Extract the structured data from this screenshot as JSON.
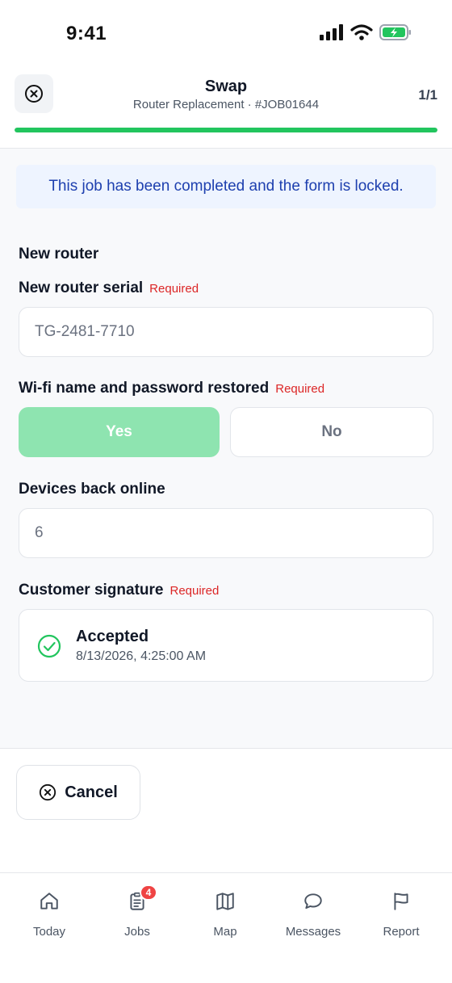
{
  "status_bar": {
    "time": "9:41"
  },
  "header": {
    "title": "Swap",
    "subtitle": "Router Replacement · #JOB01644",
    "step_count": "1/1",
    "progress": 1.0
  },
  "form": {
    "locked_message": "This job has been completed and the form is locked.",
    "section_title": "New router",
    "required_label": "Required",
    "router_serial": {
      "label": "New router serial",
      "value": "TG-2481-7710"
    },
    "wifi_restored": {
      "label": "Wi-fi name and password restored",
      "yes_label": "Yes",
      "no_label": "No",
      "selected": "Yes"
    },
    "devices_online": {
      "label": "Devices back online",
      "value": "6"
    },
    "signature": {
      "label": "Customer signature",
      "status": "Accepted",
      "timestamp": "8/13/2026, 4:25:00 AM"
    }
  },
  "footer": {
    "cancel_label": "Cancel"
  },
  "nav": {
    "items": [
      {
        "label": "Today",
        "icon": "home-icon"
      },
      {
        "label": "Jobs",
        "icon": "clipboard-icon",
        "badge": "4"
      },
      {
        "label": "Map",
        "icon": "map-icon"
      },
      {
        "label": "Messages",
        "icon": "message-icon"
      },
      {
        "label": "Report",
        "icon": "flag-icon"
      }
    ]
  },
  "colors": {
    "accent_green": "#22c55e",
    "required_red": "#dc2626",
    "banner_blue": "#1e40af"
  }
}
